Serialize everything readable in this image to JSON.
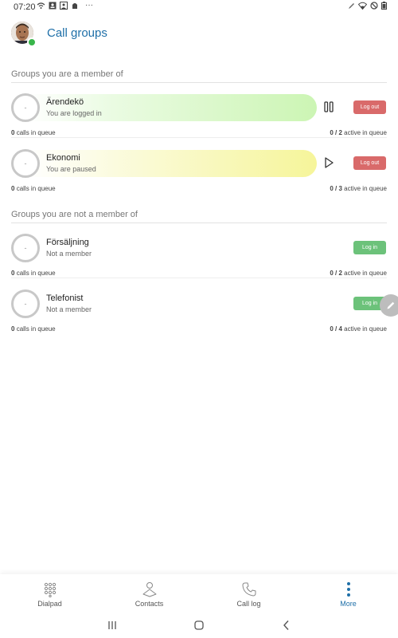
{
  "status_bar": {
    "time": "07:20",
    "left_icons": [
      "wifi-calling-icon",
      "contact-card-icon",
      "person-icon",
      "android-icon"
    ],
    "more_dots": "···",
    "right_icons": [
      "pencil-icon",
      "wifi-icon",
      "do-not-disturb-icon",
      "battery-icon"
    ]
  },
  "header": {
    "title": "Call groups",
    "presence_color": "#39b54a"
  },
  "member_section": {
    "title": "Groups you are a member of",
    "groups": [
      {
        "name": "Ärendekö",
        "status": "You are logged in",
        "ring_label": "-",
        "bar_color": "green",
        "action_icon": "pause-icon",
        "button_label": "Log out",
        "queue_count": "0",
        "queue_text": "calls in queue",
        "active": "0 / 2",
        "active_text": "active in queue"
      },
      {
        "name": "Ekonomi",
        "status": "You are paused",
        "ring_label": "-",
        "bar_color": "yellow",
        "action_icon": "play-icon",
        "button_label": "Log out",
        "queue_count": "0",
        "queue_text": "calls in queue",
        "active": "0 / 3",
        "active_text": "active in queue"
      }
    ]
  },
  "nonmember_section": {
    "title": "Groups you are not a member of",
    "groups": [
      {
        "name": "Försäljning",
        "status": "Not a member",
        "ring_label": "-",
        "button_label": "Log in",
        "queue_count": "0",
        "queue_text": "calls in queue",
        "active": "0 / 2",
        "active_text": "active in queue"
      },
      {
        "name": "Telefonist",
        "status": "Not a member",
        "ring_label": "-",
        "button_label": "Log in",
        "queue_count": "0",
        "queue_text": "calls in queue",
        "active": "0 / 4",
        "active_text": "active in queue"
      }
    ]
  },
  "fab": {
    "icon": "edit-pencil-icon"
  },
  "bottom_nav": {
    "items": [
      {
        "label": "Dialpad",
        "icon": "dialpad-icon",
        "active": false
      },
      {
        "label": "Contacts",
        "icon": "contacts-icon",
        "active": false
      },
      {
        "label": "Call log",
        "icon": "phone-icon",
        "active": false
      },
      {
        "label": "More",
        "icon": "more-vertical-icon",
        "active": true
      }
    ]
  },
  "system_nav": [
    "recent-apps-icon",
    "home-icon",
    "back-icon"
  ],
  "colors": {
    "accent": "#1e6fa8",
    "logout": "#d96a6a",
    "login": "#6cc27a",
    "logged_in_bar": "#ccf5b4",
    "paused_bar": "#f6f59a"
  }
}
